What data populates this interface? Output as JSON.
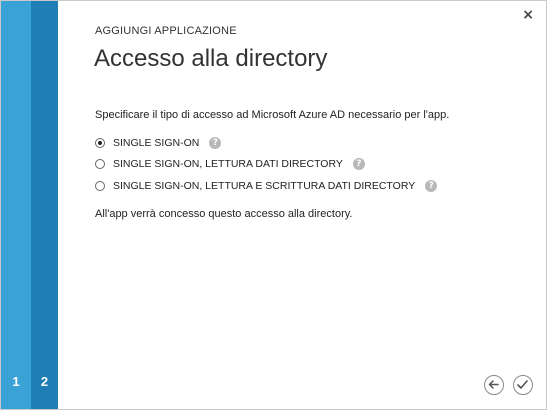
{
  "dialog": {
    "subtitle": "AGGIUNGI APPLICAZIONE",
    "title": "Accesso alla directory",
    "description": "Specificare il tipo di accesso ad Microsoft Azure AD necessario per l'app.",
    "note": "All'app verrà concesso questo accesso alla directory.",
    "close_label": "×",
    "help_glyph": "?"
  },
  "steps": [
    {
      "number": "1",
      "color": "#3aa2d4"
    },
    {
      "number": "2",
      "color": "#1f7fb4"
    }
  ],
  "options": [
    {
      "label": "SINGLE SIGN-ON",
      "selected": true
    },
    {
      "label": "SINGLE SIGN-ON, LETTURA DATI DIRECTORY",
      "selected": false
    },
    {
      "label": "SINGLE SIGN-ON, LETTURA E SCRITTURA DATI DIRECTORY",
      "selected": false
    }
  ],
  "footer": {
    "back_icon": "arrow-left-icon",
    "finish_icon": "checkmark-icon"
  }
}
